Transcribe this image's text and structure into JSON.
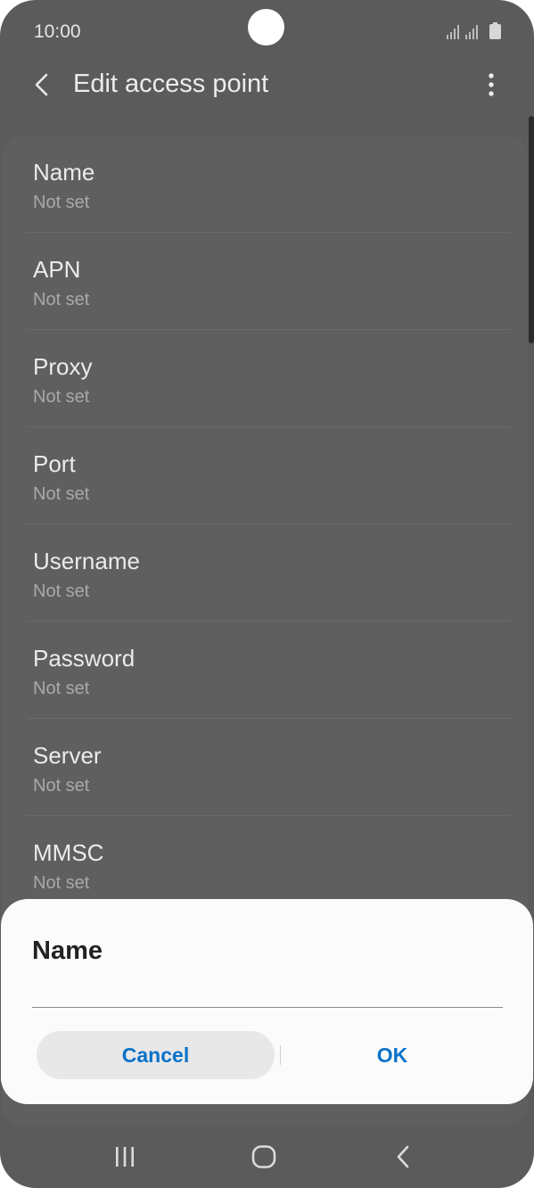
{
  "status_bar": {
    "time": "10:00",
    "icons": [
      "signal-icon",
      "signal-icon",
      "battery-icon"
    ]
  },
  "app_bar": {
    "title": "Edit access point",
    "back_icon": "back-arrow-icon",
    "menu_icon": "more-options-icon"
  },
  "fields": [
    {
      "label": "Name",
      "value": "Not set"
    },
    {
      "label": "APN",
      "value": "Not set"
    },
    {
      "label": "Proxy",
      "value": "Not set"
    },
    {
      "label": "Port",
      "value": "Not set"
    },
    {
      "label": "Username",
      "value": "Not set"
    },
    {
      "label": "Password",
      "value": "Not set"
    },
    {
      "label": "Server",
      "value": "Not set"
    },
    {
      "label": "MMSC",
      "value": "Not set"
    }
  ],
  "dialog": {
    "title": "Name",
    "input_value": "",
    "cancel_label": "Cancel",
    "ok_label": "OK"
  },
  "nav_bar": {
    "icons": [
      "recent-apps-icon",
      "home-icon",
      "back-icon"
    ]
  },
  "colors": {
    "accent": "#0a72c9",
    "scrim": "#5b5b5b",
    "dialog_bg": "#fbfbfb"
  }
}
